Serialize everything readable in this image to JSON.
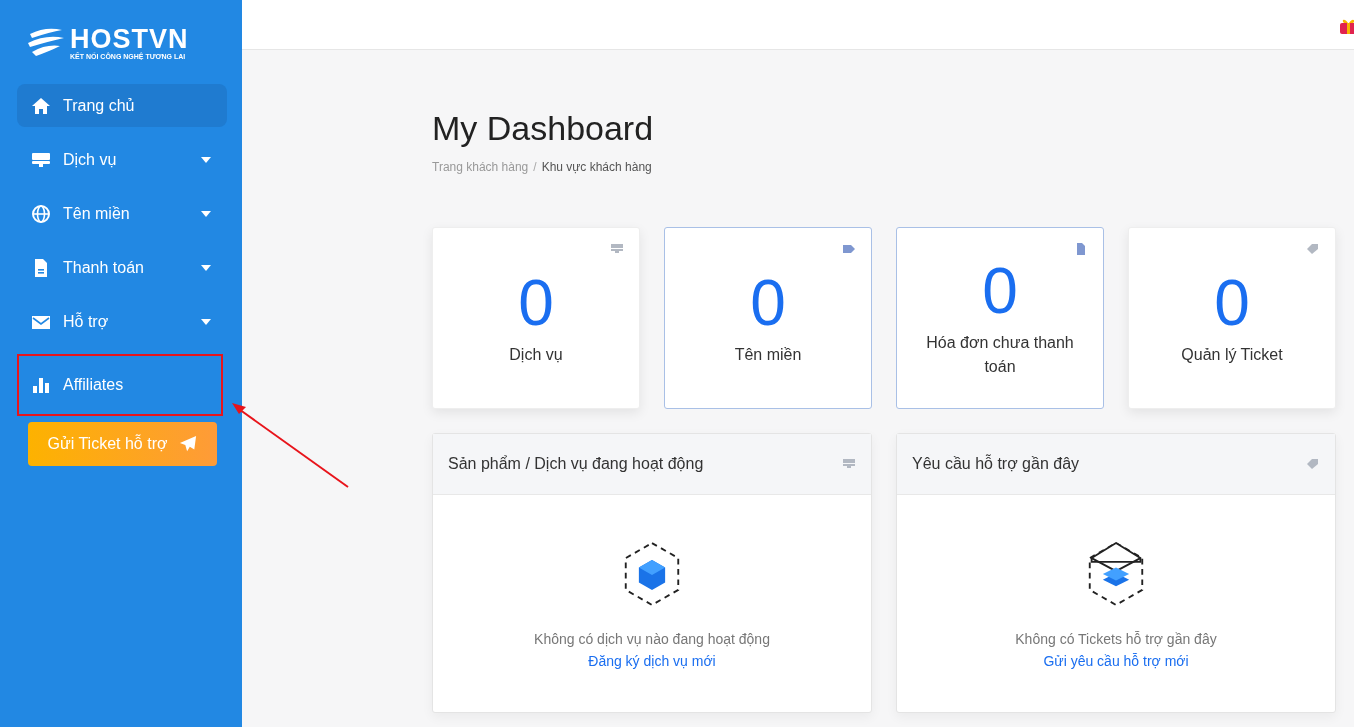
{
  "sidebar": {
    "logo": {
      "name": "HOSTVN",
      "tagline": "KẾT NỐI CÔNG NGHỆ TƯƠNG LAI"
    },
    "items": [
      {
        "label": "Trang chủ",
        "selected": true,
        "has_submenu": false,
        "highlighted": false
      },
      {
        "label": "Dịch vụ",
        "selected": false,
        "has_submenu": true,
        "highlighted": false
      },
      {
        "label": "Tên miền",
        "selected": false,
        "has_submenu": true,
        "highlighted": false
      },
      {
        "label": "Thanh toán",
        "selected": false,
        "has_submenu": true,
        "highlighted": false
      },
      {
        "label": "Hỗ trợ",
        "selected": false,
        "has_submenu": true,
        "highlighted": false
      },
      {
        "label": "Affiliates",
        "selected": false,
        "has_submenu": false,
        "highlighted": true
      }
    ],
    "ticket_button": "Gửi Ticket hỗ trợ"
  },
  "page": {
    "title": "My Dashboard",
    "breadcrumb": [
      "Trang khách hàng",
      "Khu vực khách hàng"
    ],
    "breadcrumb_separator": "/"
  },
  "stats": [
    {
      "value": "0",
      "label": "Dịch vụ",
      "bordered": false
    },
    {
      "value": "0",
      "label": "Tên miền",
      "bordered": true
    },
    {
      "value": "0",
      "label": "Hóa đơn chưa thanh toán",
      "bordered": true
    },
    {
      "value": "0",
      "label": "Quản lý Ticket",
      "bordered": false
    }
  ],
  "panels": [
    {
      "title": "Sản phẩm / Dịch vụ đang hoạt động",
      "message": "Không có dịch vụ nào đang hoạt động",
      "link": "Đăng ký dịch vụ mới"
    },
    {
      "title": "Yêu cầu hỗ trợ gần đây",
      "message": "Không có Tickets hỗ trợ gần đây",
      "link": "Gửi yêu cầu hỗ trợ mới"
    }
  ]
}
